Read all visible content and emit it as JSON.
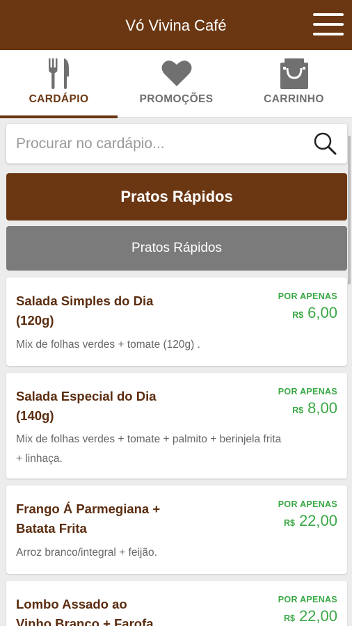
{
  "header": {
    "title": "Vó Vivina Café",
    "menu_icon": "hamburger-icon"
  },
  "tabs": [
    {
      "label": "CARDÁPIO",
      "icon": "fork-knife-icon",
      "active": true
    },
    {
      "label": "PROMOÇÕES",
      "icon": "heart-icon",
      "active": false
    },
    {
      "label": "CARRINHO",
      "icon": "shopping-bag-icon",
      "active": false
    }
  ],
  "search": {
    "placeholder": "Procurar no cardápio...",
    "value": "",
    "icon": "search-icon"
  },
  "categories": {
    "header": "Pratos Rápidos",
    "subheader": "Pratos Rápidos"
  },
  "menu_items": [
    {
      "name_l1": "Salada Simples do Dia",
      "name_l2": "(120g)",
      "desc_l1": "Mix de folhas verdes + tomate (120g) .",
      "desc_l2": "",
      "promo": "POR APENAS",
      "currency": "R$",
      "price": "6,00"
    },
    {
      "name_l1": "Salada Especial do Dia",
      "name_l2": "(140g)",
      "desc_l1": "Mix de folhas verdes + tomate + palmito + berinjela frita",
      "desc_l2": "+ linhaça.",
      "promo": "POR APENAS",
      "currency": "R$",
      "price": "8,00"
    },
    {
      "name_l1": "Frango Á Parmegiana +",
      "name_l2": "Batata Frita",
      "desc_l1": "Arroz branco/integral + feijão.",
      "desc_l2": "",
      "promo": "POR APENAS",
      "currency": "R$",
      "price": "22,00"
    },
    {
      "name_l1": "Lombo Assado ao",
      "name_l2": "Vinho Branco + Farofa",
      "desc_l1": "",
      "desc_l2": "",
      "promo": "POR APENAS",
      "currency": "R$",
      "price": "22,00"
    }
  ],
  "colors": {
    "brand_brown": "#6a3712",
    "price_green": "#39a845",
    "category_gray": "#7b7b7b"
  }
}
